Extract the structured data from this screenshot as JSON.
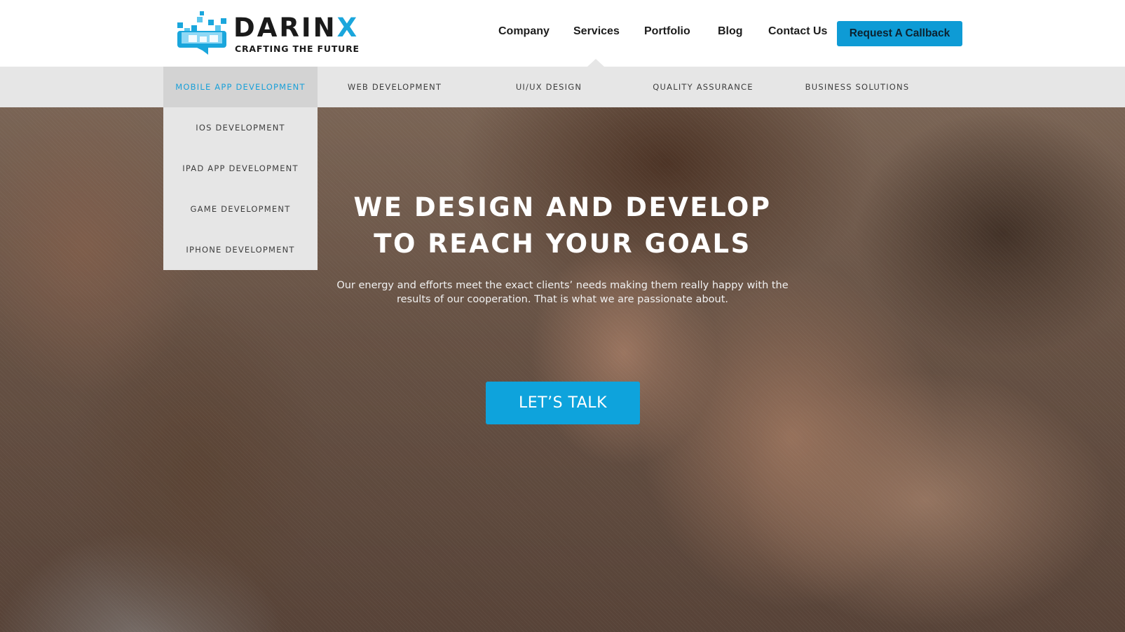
{
  "brand": {
    "name_main": "DARIN",
    "name_accent": "X",
    "tagline": "CRAFTING THE FUTURE",
    "logo_icon": "castle-pixel-logo-icon"
  },
  "nav": {
    "items": [
      "Company",
      "Services",
      "Portfolio",
      "Blog",
      "Contact Us"
    ],
    "active": "Services",
    "callback_label": "Request A Callback"
  },
  "services_menu": {
    "items": [
      "MOBILE APP DEVELOPMENT",
      "WEB DEVELOPMENT",
      "UI/UX DESIGN",
      "QUALITY ASSURANCE",
      "BUSINESS SOLUTIONS"
    ],
    "active": "MOBILE APP DEVELOPMENT",
    "dropdown": [
      "IOS DEVELOPMENT",
      "IPAD APP DEVELOPMENT",
      "GAME DEVELOPMENT",
      "IPHONE DEVELOPMENT"
    ]
  },
  "hero": {
    "title_line1": "WE DESIGN AND DEVELOP",
    "title_line2": "TO REACH YOUR GOALS",
    "text": "Our energy and efforts meet the exact clients’ needs making them really happy with the results of our cooperation. That is what we are passionate about.",
    "cta_label": "LET’S TALK"
  },
  "colors": {
    "accent": "#0e9bd5",
    "submenu_bg": "#e6e6e6",
    "submenu_active_bg": "#d3d3d3",
    "submenu_active_text": "#1aa0d8"
  }
}
